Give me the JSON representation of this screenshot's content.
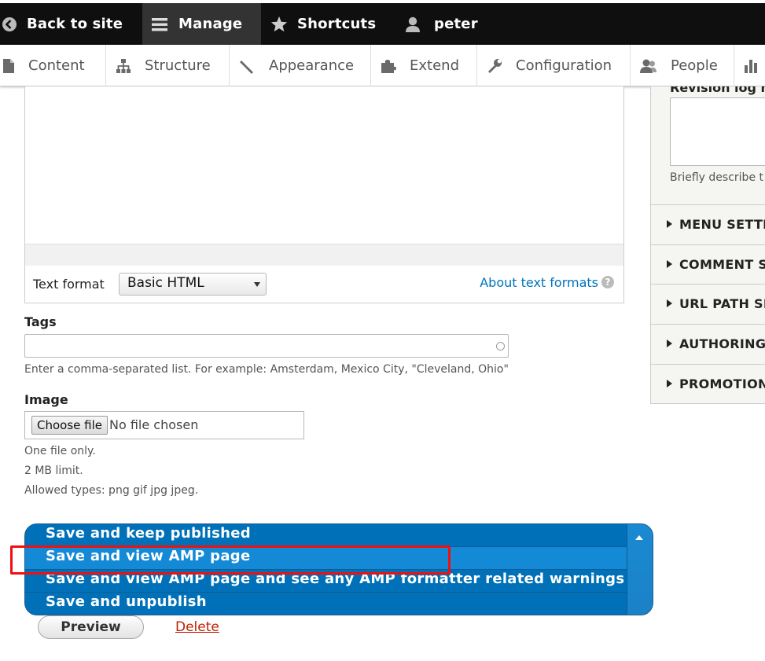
{
  "toolbar": {
    "back_to_site": "Back to site",
    "manage": "Manage",
    "shortcuts": "Shortcuts",
    "user": "peter"
  },
  "tray": {
    "items": [
      "Content",
      "Structure",
      "Appearance",
      "Extend",
      "Configuration",
      "People"
    ]
  },
  "editor": {
    "text_format_label": "Text format",
    "text_format_value": "Basic HTML",
    "about_text_formats": "About text formats",
    "help_glyph": "?"
  },
  "tags": {
    "label": "Tags",
    "value": "",
    "description": "Enter a comma-separated list. For example: Amsterdam, Mexico City, \"Cleveland, Ohio\""
  },
  "image": {
    "label": "Image",
    "choose_button": "Choose file",
    "status": "No file chosen",
    "help": [
      "One file only.",
      "2 MB limit.",
      "Allowed types: png gif jpg jpeg."
    ]
  },
  "save_actions": [
    "Save and keep published",
    "Save and view AMP page",
    "Save and view AMP page and see any AMP formatter related warnings",
    "Save and unpublish"
  ],
  "actions": {
    "preview": "Preview",
    "delete": "Delete"
  },
  "sidebar": {
    "revision_label": "Revision log m",
    "revision_description": "Briefly describe t",
    "sections": [
      "MENU SETTI",
      "COMMENT S",
      "URL PATH SE",
      "AUTHORING",
      "PROMOTION"
    ]
  },
  "colors": {
    "toolbar_bg": "#0f0f0f",
    "primary_button": "#0071b8",
    "link": "#0074bd",
    "danger_link": "#c11f00",
    "highlight": "#ef1010"
  }
}
